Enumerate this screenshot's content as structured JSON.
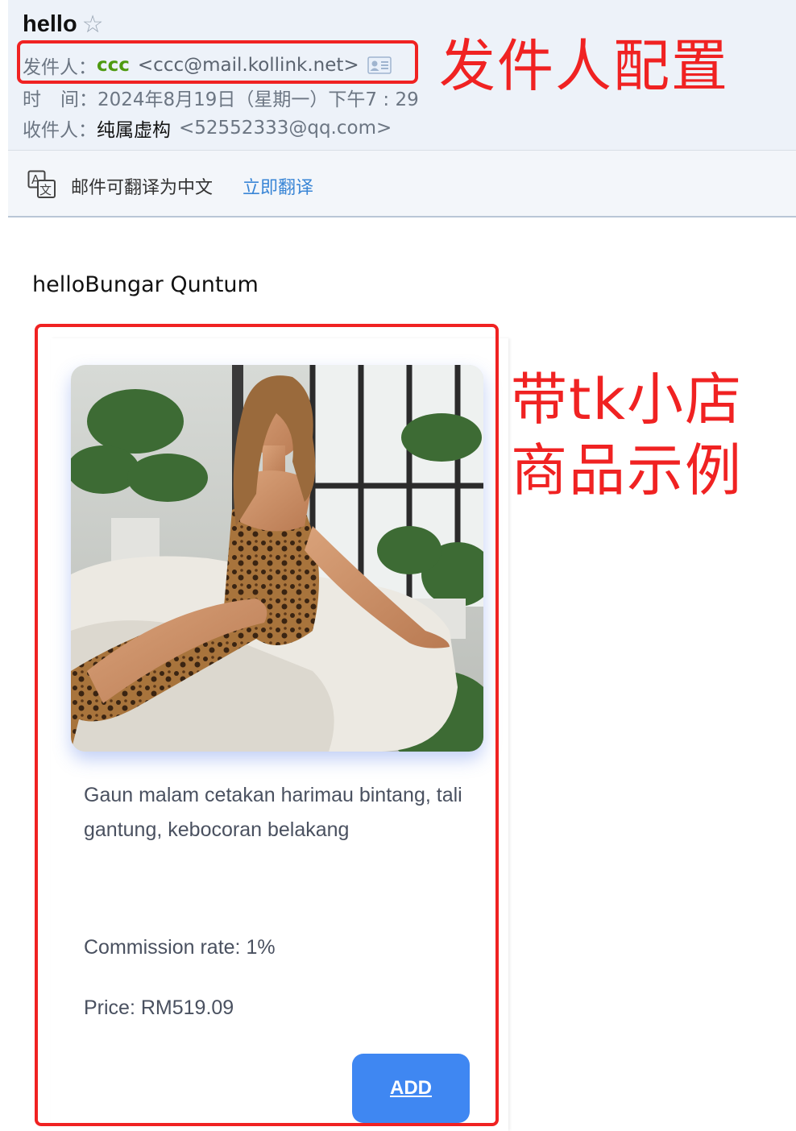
{
  "mail": {
    "subject": "hello",
    "sender_label": "发件人：",
    "sender_name": "ccc",
    "sender_address": "<ccc@mail.kollink.net>",
    "time_label_1": "时",
    "time_label_2": "间：",
    "time_value": "2024年8月19日（星期一）下午7 : 29",
    "recipient_label": "收件人：",
    "recipient_name": "纯属虚构",
    "recipient_address": "<52552333@qq.com>"
  },
  "translate_bar": {
    "text": "邮件可翻译为中文",
    "link": "立即翻译"
  },
  "annotations": {
    "sender_config": "发件人配置",
    "product_line1": "带tk小店",
    "product_line2": "商品示例",
    "color": "#f02222"
  },
  "body": {
    "greeting": "helloBungar Quntum"
  },
  "product": {
    "title": "Gaun malam cetakan harimau bintang, tali gantung, kebocoran belakang",
    "commission": "Commission rate: 1%",
    "price": "Price: RM519.09",
    "add_label": "ADD",
    "button_color": "#3f87f2"
  },
  "icons": {
    "star": "star-outline-icon",
    "vcard": "contact-card-icon",
    "translate": "translate-icon"
  }
}
